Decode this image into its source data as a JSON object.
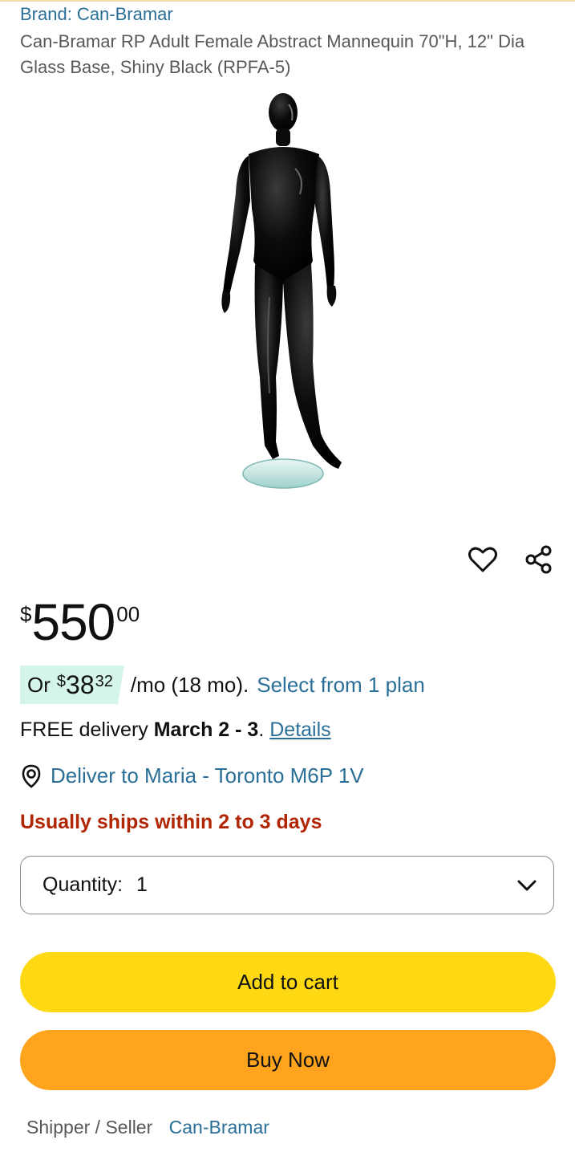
{
  "product": {
    "brand": "Brand: Can-Bramar",
    "title": "Can-Bramar RP Adult Female Abstract Mannequin 70\"H, 12\" Dia Glass Base, Shiny Black (RPFA-5)",
    "image_icon": "mannequin-image"
  },
  "actions": {
    "wishlist_icon": "heart-icon",
    "share_icon": "share-icon"
  },
  "price": {
    "currency": "$",
    "whole": "550",
    "fraction": "00"
  },
  "installment": {
    "prefix": "Or",
    "currency": "$",
    "whole": "38",
    "fraction": "32",
    "term": "/mo (18 mo).",
    "plan_link": "Select from 1 plan"
  },
  "delivery": {
    "prefix": "FREE delivery",
    "dates": "March 2 - 3",
    "suffix": ".",
    "details_link": "Details"
  },
  "deliver_to": {
    "icon": "location-pin-icon",
    "text": "Deliver to Maria - Toronto M6P 1V"
  },
  "availability": {
    "text": "Usually ships within 2 to 3 days"
  },
  "quantity": {
    "label": "Quantity:",
    "value": "1"
  },
  "buttons": {
    "add_to_cart": "Add to cart",
    "buy_now": "Buy Now"
  },
  "seller": {
    "label": "Shipper / Seller",
    "name": "Can-Bramar"
  },
  "colors": {
    "link": "#2a6f97",
    "add_to_cart": "#ffd814",
    "buy_now": "#ffa41c",
    "availability": "#b12704",
    "installment_badge": "#d6f5ea"
  }
}
